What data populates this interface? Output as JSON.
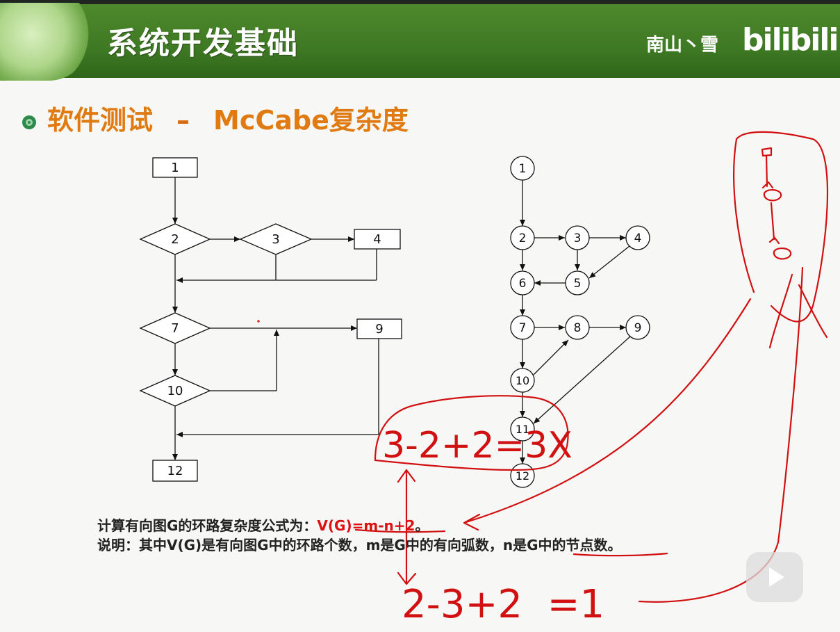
{
  "header": {
    "title": "系统开发基础",
    "author": "南山丶雪",
    "logo": "bilibili"
  },
  "subtitle": {
    "part1": "软件测试",
    "dash": "–",
    "part2": "McCabe复杂度"
  },
  "flowchart_left": {
    "boxes": [
      "1",
      "4",
      "9",
      "12"
    ],
    "diamonds": [
      "2",
      "3",
      "7",
      "10"
    ]
  },
  "flowgraph_right": {
    "nodes": [
      "1",
      "2",
      "3",
      "4",
      "5",
      "6",
      "7",
      "8",
      "9",
      "10",
      "11",
      "12"
    ]
  },
  "notes": {
    "line1_prefix": "计算有向图G的环路复杂度公式为：",
    "line1_formula": "V(G)=m-n+2",
    "line1_suffix": "。",
    "line2": "说明：其中V(G)是有向图G中的环路个数，m是G中的有向弧数，n是G中的节点数。"
  },
  "annotations": {
    "calc1": "3-2+2=3X",
    "calc2": "2-3+2  =1"
  },
  "colors": {
    "header_green": "#3f7a24",
    "accent_orange": "#e07a12",
    "ink_red": "#d11111"
  }
}
